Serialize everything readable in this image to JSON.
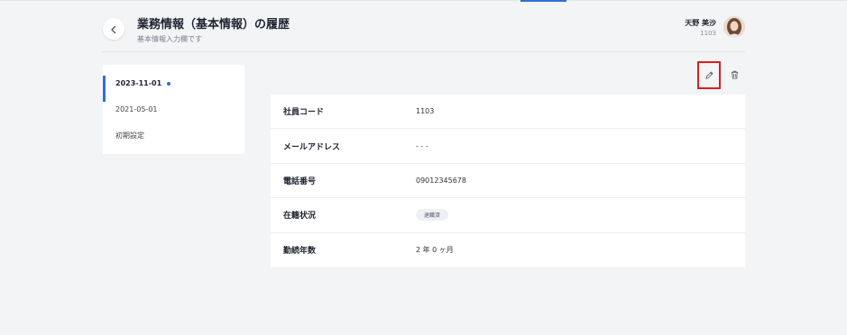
{
  "header": {
    "title": "業務情報（基本情報）の履歴",
    "subtitle": "基本情報入力欄です"
  },
  "user": {
    "name": "天野 美沙",
    "id": "1103"
  },
  "history": {
    "items": [
      {
        "label": "2023-11-01",
        "active": true
      },
      {
        "label": "2021-05-01",
        "active": false
      },
      {
        "label": "初期設定",
        "active": false
      }
    ]
  },
  "detail": {
    "rows": [
      {
        "label": "社員コード",
        "value": "1103"
      },
      {
        "label": "メールアドレス",
        "value": "- - -"
      },
      {
        "label": "電話番号",
        "value": "09012345678"
      },
      {
        "label": "在籍状況",
        "value": "退職済"
      },
      {
        "label": "勤続年数",
        "value": "2 年 0 ヶ月"
      }
    ]
  },
  "icons": {
    "back": "chevron-left-icon",
    "edit": "pencil-icon",
    "delete": "trash-icon"
  },
  "colors": {
    "accent": "#2f6fd6",
    "highlight": "#e01c1c",
    "background": "#f3f4f6"
  }
}
